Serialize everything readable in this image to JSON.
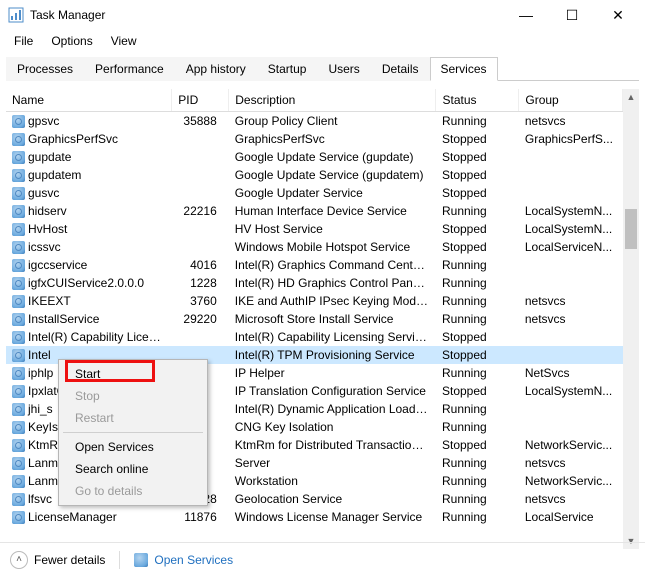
{
  "window": {
    "title": "Task Manager",
    "controls": {
      "min": "—",
      "max": "☐",
      "close": "✕"
    }
  },
  "menu": [
    "File",
    "Options",
    "View"
  ],
  "tabs": [
    "Processes",
    "Performance",
    "App history",
    "Startup",
    "Users",
    "Details",
    "Services"
  ],
  "active_tab": "Services",
  "columns": [
    "Name",
    "PID",
    "Description",
    "Status",
    "Group"
  ],
  "services": [
    {
      "name": "gpsvc",
      "pid": "35888",
      "desc": "Group Policy Client",
      "status": "Running",
      "group": "netsvcs"
    },
    {
      "name": "GraphicsPerfSvc",
      "pid": "",
      "desc": "GraphicsPerfSvc",
      "status": "Stopped",
      "group": "GraphicsPerfS..."
    },
    {
      "name": "gupdate",
      "pid": "",
      "desc": "Google Update Service (gupdate)",
      "status": "Stopped",
      "group": ""
    },
    {
      "name": "gupdatem",
      "pid": "",
      "desc": "Google Update Service (gupdatem)",
      "status": "Stopped",
      "group": ""
    },
    {
      "name": "gusvc",
      "pid": "",
      "desc": "Google Updater Service",
      "status": "Stopped",
      "group": ""
    },
    {
      "name": "hidserv",
      "pid": "22216",
      "desc": "Human Interface Device Service",
      "status": "Running",
      "group": "LocalSystemN..."
    },
    {
      "name": "HvHost",
      "pid": "",
      "desc": "HV Host Service",
      "status": "Stopped",
      "group": "LocalSystemN..."
    },
    {
      "name": "icssvc",
      "pid": "",
      "desc": "Windows Mobile Hotspot Service",
      "status": "Stopped",
      "group": "LocalServiceN..."
    },
    {
      "name": "igccservice",
      "pid": "4016",
      "desc": "Intel(R) Graphics Command Center ...",
      "status": "Running",
      "group": ""
    },
    {
      "name": "igfxCUIService2.0.0.0",
      "pid": "1228",
      "desc": "Intel(R) HD Graphics Control Panel S...",
      "status": "Running",
      "group": ""
    },
    {
      "name": "IKEEXT",
      "pid": "3760",
      "desc": "IKE and AuthIP IPsec Keying Modules",
      "status": "Running",
      "group": "netsvcs"
    },
    {
      "name": "InstallService",
      "pid": "29220",
      "desc": "Microsoft Store Install Service",
      "status": "Running",
      "group": "netsvcs"
    },
    {
      "name": "Intel(R) Capability Licensin...",
      "pid": "",
      "desc": "Intel(R) Capability Licensing Service ...",
      "status": "Stopped",
      "group": ""
    },
    {
      "name": "Intel",
      "pid": "",
      "desc": "Intel(R) TPM Provisioning Service",
      "status": "Stopped",
      "group": "",
      "selected": true
    },
    {
      "name": "iphlp",
      "pid": "",
      "desc": "IP Helper",
      "status": "Running",
      "group": "NetSvcs"
    },
    {
      "name": "IpxlatCfgSvc",
      "pid": "",
      "desc": "IP Translation Configuration Service",
      "status": "Stopped",
      "group": "LocalSystemN..."
    },
    {
      "name": "jhi_s",
      "pid": "",
      "desc": "Intel(R) Dynamic Application Loader...",
      "status": "Running",
      "group": ""
    },
    {
      "name": "KeyIso",
      "pid": "",
      "desc": "CNG Key Isolation",
      "status": "Running",
      "group": ""
    },
    {
      "name": "KtmRm",
      "pid": "",
      "desc": "KtmRm for Distributed Transaction C...",
      "status": "Stopped",
      "group": "NetworkServic..."
    },
    {
      "name": "LanmanServer",
      "pid": "",
      "desc": "Server",
      "status": "Running",
      "group": "netsvcs"
    },
    {
      "name": "LanmanWorkstation",
      "pid": "",
      "desc": "Workstation",
      "status": "Running",
      "group": "NetworkServic..."
    },
    {
      "name": "lfsvc",
      "pid": "10928",
      "desc": "Geolocation Service",
      "status": "Running",
      "group": "netsvcs"
    },
    {
      "name": "LicenseManager",
      "pid": "11876",
      "desc": "Windows License Manager Service",
      "status": "Running",
      "group": "LocalService"
    }
  ],
  "context_menu": {
    "items": [
      {
        "label": "Start",
        "enabled": true
      },
      {
        "label": "Stop",
        "enabled": false
      },
      {
        "label": "Restart",
        "enabled": false
      },
      {
        "sep": true
      },
      {
        "label": "Open Services",
        "enabled": true
      },
      {
        "label": "Search online",
        "enabled": true
      },
      {
        "label": "Go to details",
        "enabled": false
      }
    ]
  },
  "footer": {
    "fewer": "Fewer details",
    "open_services": "Open Services"
  }
}
